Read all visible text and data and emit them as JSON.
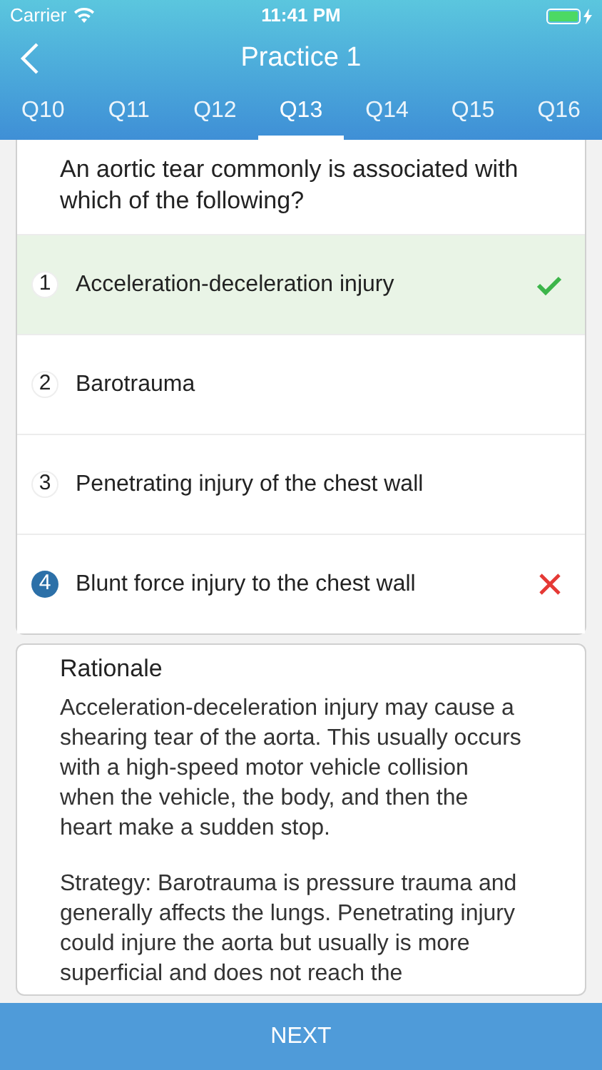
{
  "status_bar": {
    "carrier": "Carrier",
    "time": "11:41 PM"
  },
  "nav": {
    "title": "Practice 1"
  },
  "tabs": [
    {
      "label": "Q10",
      "selected": false
    },
    {
      "label": "Q11",
      "selected": false
    },
    {
      "label": "Q12",
      "selected": false
    },
    {
      "label": "Q13",
      "selected": true
    },
    {
      "label": "Q14",
      "selected": false
    },
    {
      "label": "Q15",
      "selected": false
    },
    {
      "label": "Q16",
      "selected": false
    }
  ],
  "question": "An aortic tear commonly is associated with which of the following?",
  "options": [
    {
      "number": "1",
      "text": "Acceleration-deceleration injury",
      "selected": false,
      "correct": true
    },
    {
      "number": "2",
      "text": "Barotrauma",
      "selected": false,
      "correct": false
    },
    {
      "number": "3",
      "text": "Penetrating injury of the chest wall",
      "selected": false,
      "correct": false
    },
    {
      "number": "4",
      "text": "Blunt force injury to the chest wall",
      "selected": true,
      "correct": false
    }
  ],
  "rationale": {
    "title": "Rationale",
    "paragraphs": [
      "Acceleration-deceleration injury may cause a shearing tear of the aorta. This usually occurs with a high-speed motor vehicle collision when the vehicle, the body, and then the heart make a sudden stop.",
      "Strategy: Barotrauma is pressure trauma and generally affects the lungs. Penetrating injury could injure the aorta but usually is more superficial and does not reach the"
    ]
  },
  "next_button": "NEXT"
}
